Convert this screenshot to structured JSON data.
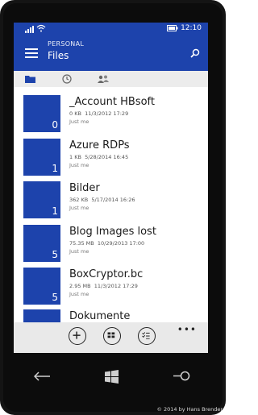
{
  "status": {
    "time": "12:10"
  },
  "header": {
    "subtitle": "PERSONAL",
    "title": "Files"
  },
  "tabs": [
    {
      "icon": "folder-icon",
      "selected": true
    },
    {
      "icon": "clock-icon",
      "selected": false
    },
    {
      "icon": "people-icon",
      "selected": false
    }
  ],
  "files": [
    {
      "name": "_Account HBsoft",
      "size": "0 KB",
      "date": "11/3/2012 17:29",
      "owner": "Just me",
      "count": "0"
    },
    {
      "name": "Azure RDPs",
      "size": "1 KB",
      "date": "5/28/2014 16:45",
      "owner": "Just me",
      "count": "1"
    },
    {
      "name": "Bilder",
      "size": "362 KB",
      "date": "5/17/2014 16:26",
      "owner": "Just me",
      "count": "1"
    },
    {
      "name": "Blog Images lost",
      "size": "75.35 MB",
      "date": "10/29/2013 17:00",
      "owner": "Just me",
      "count": "5"
    },
    {
      "name": "BoxCryptor.bc",
      "size": "2.95 MB",
      "date": "11/3/2012 17:29",
      "owner": "Just me",
      "count": "5"
    },
    {
      "name": "Dokumente",
      "size": "",
      "date": "",
      "owner": "",
      "count": ""
    }
  ],
  "appbar": {
    "more": "•••",
    "buttons": [
      "add-icon",
      "select-all-icon",
      "checklist-icon"
    ]
  },
  "credit": "© 2014 by Hans Brender",
  "colors": {
    "accent": "#1d43ac",
    "appbar": "#e9e9e9",
    "tabbar": "#ececec"
  }
}
